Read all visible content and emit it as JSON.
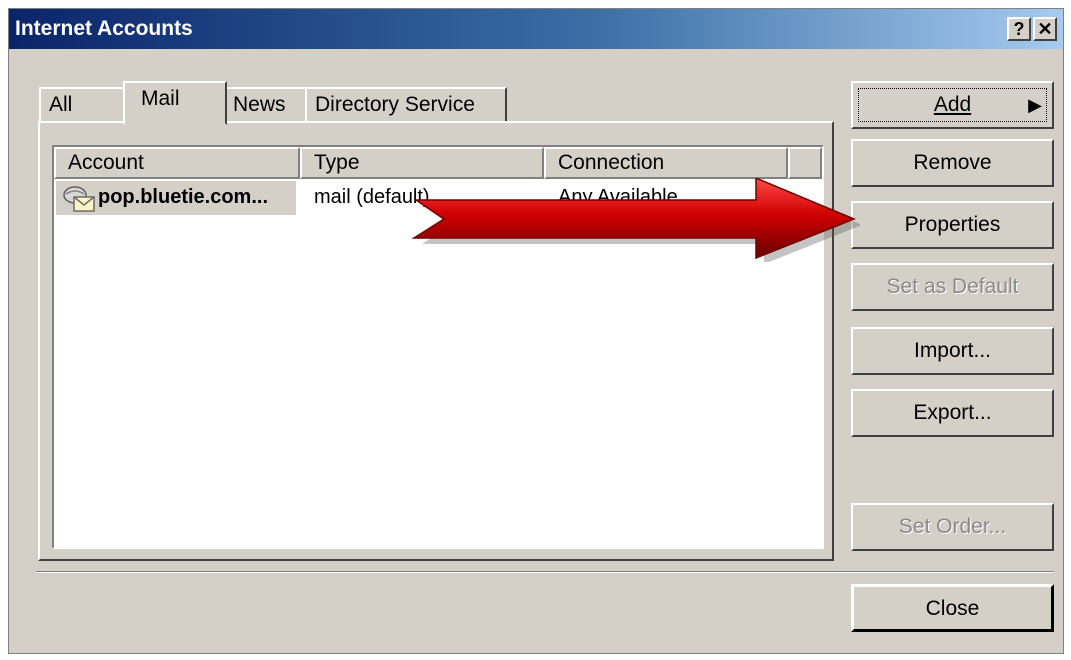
{
  "window": {
    "title": "Internet Accounts",
    "help_glyph": "?",
    "close_glyph": "✕"
  },
  "tabs": [
    {
      "label": "All"
    },
    {
      "label": "Mail"
    },
    {
      "label": "News"
    },
    {
      "label": "Directory Service"
    }
  ],
  "list": {
    "columns": [
      "Account",
      "Type",
      "Connection"
    ],
    "rows": [
      {
        "account": "pop.bluetie.com...",
        "type": "mail (default)",
        "connection": "Any Available"
      }
    ]
  },
  "buttons": {
    "add": "Add",
    "add_glyph": "▶",
    "remove": "Remove",
    "properties": "Properties",
    "set_default": "Set as Default",
    "import": "Import...",
    "export": "Export...",
    "set_order": "Set Order...",
    "close": "Close"
  },
  "annotation": {
    "arrow_color": "#cc0000"
  }
}
